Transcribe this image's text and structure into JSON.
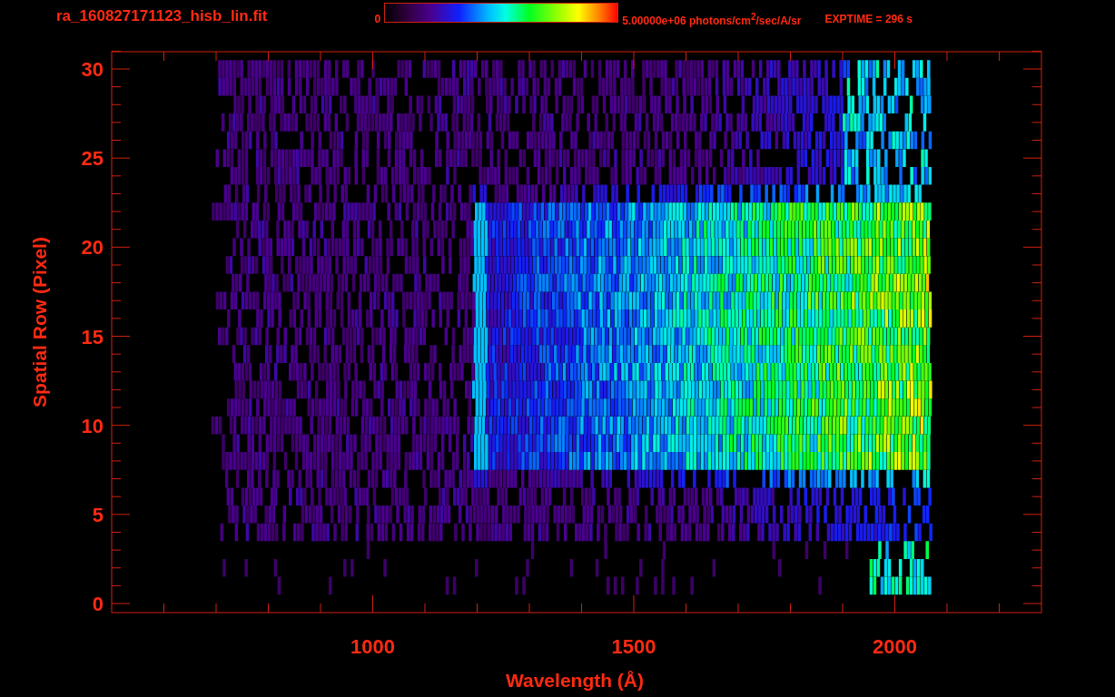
{
  "title": "ra_160827171123_hisb_lin.fit",
  "colorbar": {
    "min_label": "0",
    "max_label": "5.00000e+06 photons/cm$^{2}$/sec/A/sr"
  },
  "exposure": "EXPTIME = 296 s",
  "x_axis": {
    "label": "Wavelength (Å)",
    "ticks": [
      "1000",
      "1500",
      "2000"
    ]
  },
  "y_axis": {
    "label": "Spatial Row (Pixel)",
    "ticks": [
      "30",
      "25",
      "20",
      "15",
      "10",
      "5",
      "0"
    ]
  }
}
